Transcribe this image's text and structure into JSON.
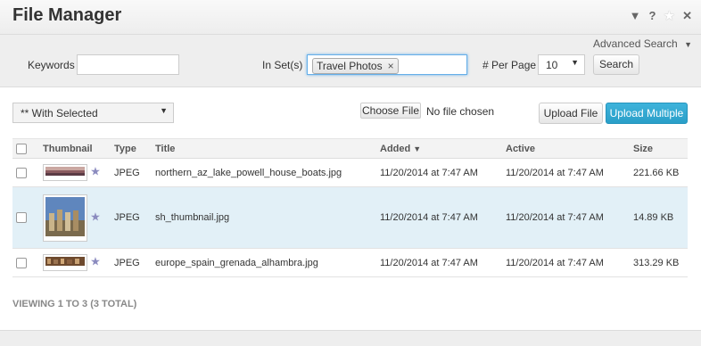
{
  "window": {
    "title": "File Manager"
  },
  "filters": {
    "advanced_search": "Advanced Search",
    "keywords_label": "Keywords",
    "keywords_value": "",
    "sets_label": "In Set(s)",
    "set_tag": "Travel Photos",
    "tag_remove": "×",
    "per_page_label": "# Per Page",
    "per_page_value": "10",
    "search_button": "Search"
  },
  "actions": {
    "with_selected": "** With Selected",
    "choose_file": "Choose File",
    "no_file": "No file chosen",
    "upload_file": "Upload File",
    "upload_multiple": "Upload Multiple"
  },
  "table": {
    "headers": {
      "thumbnail": "Thumbnail",
      "type": "Type",
      "title": "Title",
      "added": "Added",
      "active": "Active",
      "size": "Size"
    },
    "rows": [
      {
        "type": "JPEG",
        "title": "northern_az_lake_powell_house_boats.jpg",
        "added": "11/20/2014 at 7:47 AM",
        "active": "11/20/2014 at 7:47 AM",
        "size": "221.66 KB"
      },
      {
        "type": "JPEG",
        "title": "sh_thumbnail.jpg",
        "added": "11/20/2014 at 7:47 AM",
        "active": "11/20/2014 at 7:47 AM",
        "size": "14.89 KB"
      },
      {
        "type": "JPEG",
        "title": "europe_spain_grenada_alhambra.jpg",
        "added": "11/20/2014 at 7:47 AM",
        "active": "11/20/2014 at 7:47 AM",
        "size": "313.29 KB"
      }
    ]
  },
  "footer": {
    "viewing": "VIEWING 1 TO 3 (3 TOTAL)"
  },
  "colors": {
    "accent": "#2a9fc8",
    "selected_row": "#e2f0f7"
  }
}
